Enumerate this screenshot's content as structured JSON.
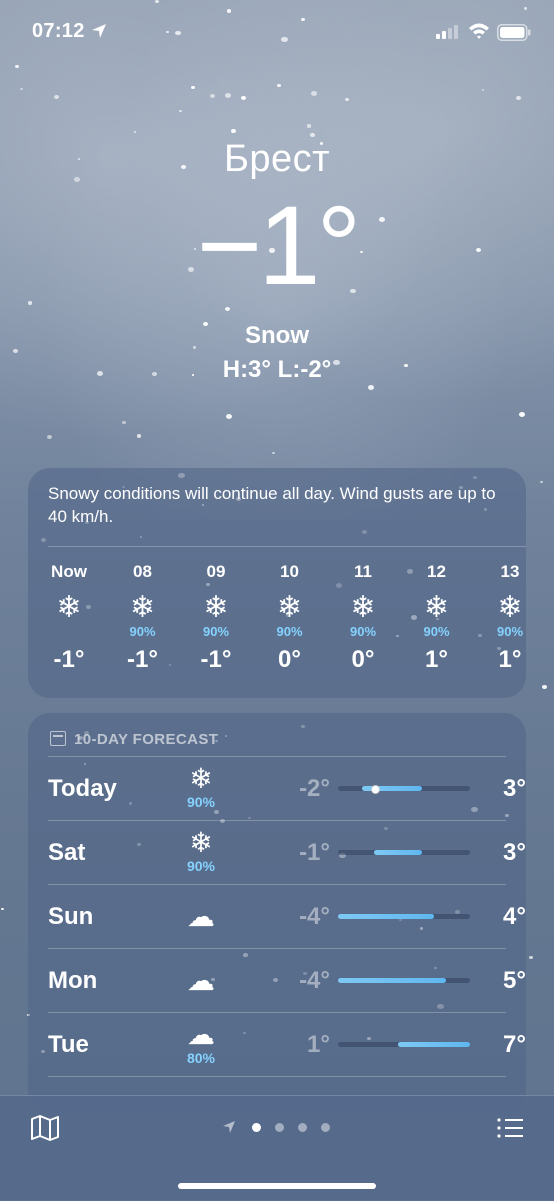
{
  "status_bar": {
    "time": "07:12"
  },
  "hero": {
    "city": "Брест",
    "temperature": "−1°",
    "condition": "Snow",
    "high_low": "H:3°  L:-2°"
  },
  "hourly": {
    "summary": "Snowy conditions will continue all day. Wind gusts are up to 40 km/h.",
    "items": [
      {
        "label": "Now",
        "icon": "snowflake-icon",
        "glyph": "❄",
        "precip": "",
        "temp": "-1°"
      },
      {
        "label": "08",
        "icon": "snowflake-icon",
        "glyph": "❄",
        "precip": "90%",
        "temp": "-1°"
      },
      {
        "label": "09",
        "icon": "snowflake-icon",
        "glyph": "❄",
        "precip": "90%",
        "temp": "-1°"
      },
      {
        "label": "10",
        "icon": "snowflake-icon",
        "glyph": "❄",
        "precip": "90%",
        "temp": "0°"
      },
      {
        "label": "11",
        "icon": "snowflake-icon",
        "glyph": "❄",
        "precip": "90%",
        "temp": "0°"
      },
      {
        "label": "12",
        "icon": "snowflake-icon",
        "glyph": "❄",
        "precip": "90%",
        "temp": "1°"
      },
      {
        "label": "13",
        "icon": "snowflake-icon",
        "glyph": "❄",
        "precip": "90%",
        "temp": "1°"
      }
    ]
  },
  "forecast": {
    "header": "10-DAY FORECAST",
    "scale_min": -4,
    "scale_max": 7,
    "current_temp": -1,
    "days": [
      {
        "name": "Today",
        "icon": "snowflake-icon",
        "glyph": "❄",
        "precip": "90%",
        "low": "-2°",
        "high": "3°",
        "low_val": -2,
        "high_val": 3
      },
      {
        "name": "Sat",
        "icon": "snowflake-icon",
        "glyph": "❄",
        "precip": "90%",
        "low": "-1°",
        "high": "3°",
        "low_val": -1,
        "high_val": 3
      },
      {
        "name": "Sun",
        "icon": "cloud-icon",
        "glyph": "☁",
        "precip": "",
        "low": "-4°",
        "high": "4°",
        "low_val": -4,
        "high_val": 4
      },
      {
        "name": "Mon",
        "icon": "cloud-icon",
        "glyph": "☁",
        "precip": "",
        "low": "-4°",
        "high": "5°",
        "low_val": -4,
        "high_val": 5
      },
      {
        "name": "Tue",
        "icon": "cloud-rain-icon",
        "glyph": "☁",
        "precip": "80%",
        "low": "1°",
        "high": "7°",
        "low_val": 1,
        "high_val": 7
      }
    ]
  },
  "colors": {
    "precip": "#85d2ff",
    "bar": "#6cbff3"
  }
}
